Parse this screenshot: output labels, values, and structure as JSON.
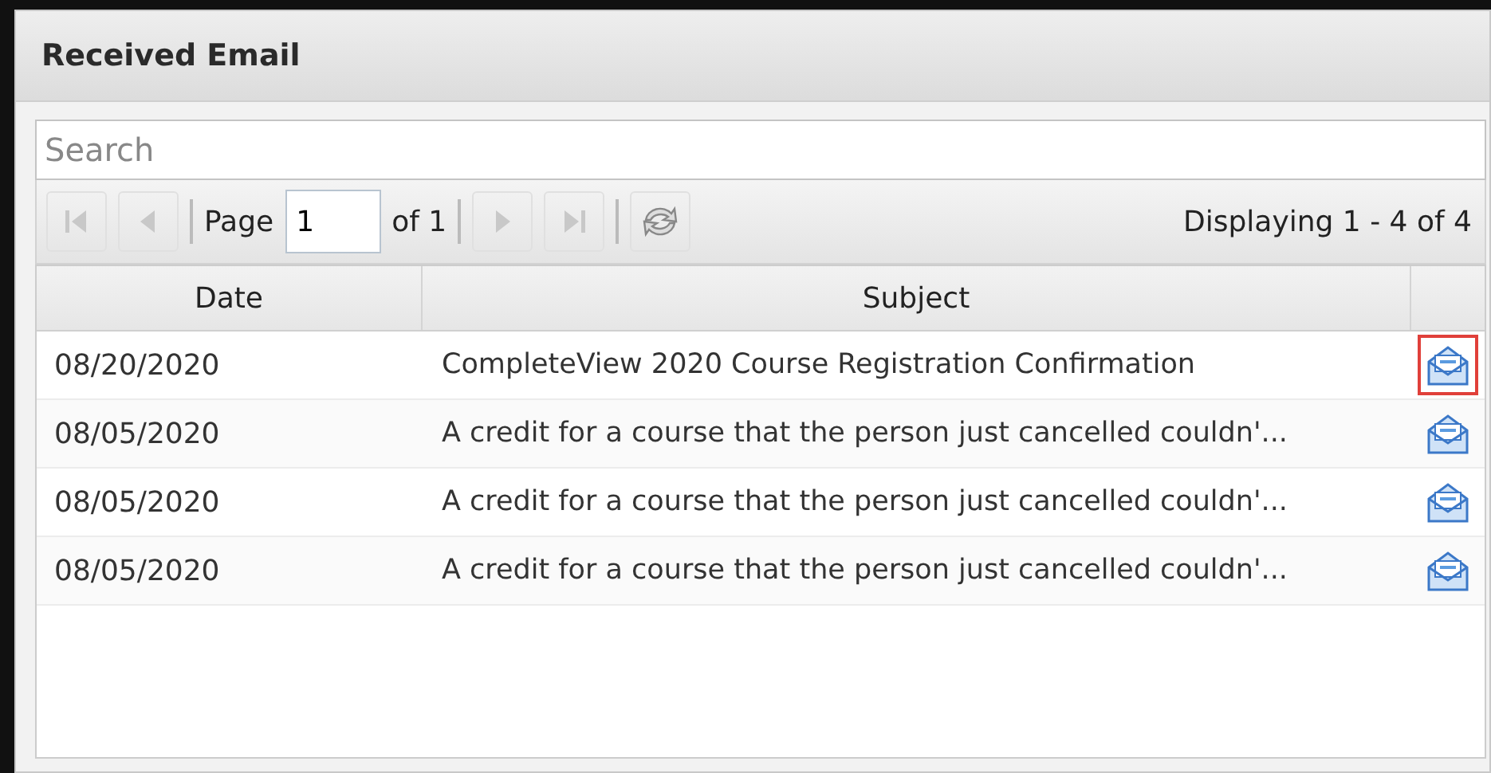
{
  "panel": {
    "title": "Received Email"
  },
  "search": {
    "placeholder": "Search"
  },
  "pager": {
    "buttons": [
      {
        "kind": "first",
        "disabled": true
      },
      {
        "kind": "prev",
        "disabled": true
      }
    ],
    "page_label": "Page",
    "page_value": "1",
    "of_label": "of 1",
    "buttons_after": [
      {
        "kind": "next",
        "disabled": true
      },
      {
        "kind": "last",
        "disabled": true
      },
      {
        "kind": "refresh"
      }
    ],
    "display_info": "Displaying 1 - 4 of 4"
  },
  "table": {
    "columns": [
      "Date",
      "Subject"
    ],
    "rows": [
      {
        "date": "08/20/2020",
        "subject": "CompleteView 2020 Course Registration Confirmation",
        "highlighted": true
      },
      {
        "date": "08/05/2020",
        "subject": "A credit for a course that the person just cancelled couldn'...",
        "highlighted": false
      },
      {
        "date": "08/05/2020",
        "subject": "A credit for a course that the person just cancelled couldn'...",
        "highlighted": false
      },
      {
        "date": "08/05/2020",
        "subject": "A credit for a course that the person just cancelled couldn'...",
        "highlighted": false
      }
    ]
  }
}
